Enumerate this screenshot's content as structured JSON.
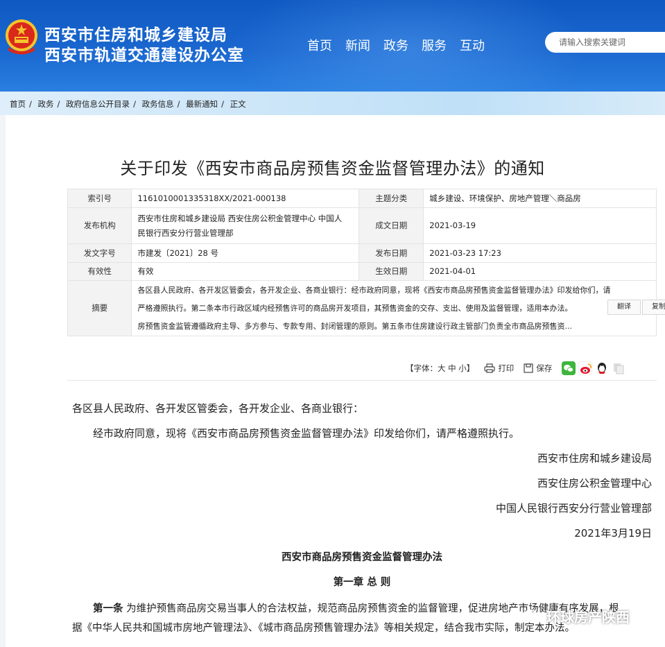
{
  "header": {
    "org_line1": "西安市住房和城乡建设局",
    "org_line2": "西安市轨道交通建设办公室",
    "nav": [
      "首页",
      "新闻",
      "政务",
      "服务",
      "互动"
    ],
    "search_placeholder": "请输入搜索关键词",
    "emblem_icon": "national-emblem-icon"
  },
  "breadcrumb": [
    "首页",
    "政务",
    "政府信息公开目录",
    "政务信息",
    "最新通知",
    "正文"
  ],
  "article": {
    "title": "关于印发《西安市商品房预售资金监督管理办法》的通知",
    "meta": {
      "index_label": "索引号",
      "index_value": "1161010001335318XX/2021-000138",
      "topic_label": "主题分类",
      "topic_value": "城乡建设、环境保护、房地产管理＼商品房",
      "issuer_label": "发布机构",
      "issuer_line1": "西安市住房和城乡建设局 西安住房公积金管理中心 中国人",
      "issuer_line2": "民银行西安分行营业管理部",
      "created_label": "成文日期",
      "created_value": "2021-03-19",
      "docno_label": "发文字号",
      "docno_value": "市建发〔2021〕28 号",
      "published_label": "发布日期",
      "published_value": "2021-03-23 17:23",
      "validity_label": "有效性",
      "validity_value": "有效",
      "effective_label": "生效日期",
      "effective_value": "2021-04-01",
      "abstract_label": "摘要",
      "abstract_line1": "各区县人民政府、各开发区管委会，各开发企业、各商业银行：经市政府同意，现将《西安市商品房预售资金监督管理办法》印发给你们，请",
      "abstract_line2": "严格遵照执行。第二条本市行政区域内经预售许可的商品房开发项目，其预售资金的交存、支出、使用及监督管理，适用本办法。",
      "abstract_line3": "房预售资金监管遵循政府主导、多方参与、专款专用、封闭管理的原则。第五条市住房建设行政主管部门负责全市商品房预售资...",
      "translate_label": "翻译",
      "copy_label": "复制"
    },
    "tools": {
      "font_label": "【字体：大 中 小】",
      "print_label": "打印",
      "save_label": "保存",
      "share_icons": [
        "wechat-icon",
        "weibo-icon",
        "qq-icon",
        "copy-link-icon"
      ]
    },
    "body": {
      "salutation": "各区县人民政府、各开发区管委会，各开发企业、各商业银行：",
      "intro": "经市政府同意，现将《西安市商品房预售资金监督管理办法》印发给你们，请严格遵照执行。",
      "signatures": [
        "西安市住房和城乡建设局",
        "西安住房公积金管理中心",
        "中国人民银行西安分行营业管理部"
      ],
      "date": "2021年3月19日",
      "doc_title": "西安市商品房预售资金监督管理办法",
      "chapter": "第一章  总  则",
      "article1_label": "第一条",
      "article1_line1": "为维护预售商品房交易当事人的合法权益，规范商品房预售资金的监督管理，促进房地产市场健康有序发展，根",
      "article1_line2": "据《中华人民共和国城市房地产管理法》、《城市商品房预售管理办法》等相关规定，结合我市实际，制定本办法。"
    }
  },
  "watermark": "环球房产陕西"
}
